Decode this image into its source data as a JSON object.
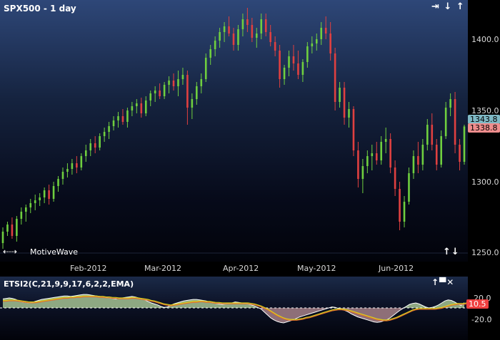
{
  "price_panel": {
    "title": "SPX500 - 1 day",
    "branding": "MotiveWave",
    "controls": {
      "right": "⇥ ↓ ↑"
    },
    "nav_arrows": "⇠⇢",
    "y_ticks": [
      "1400.0",
      "1350.0",
      "1300.0",
      "1250.0"
    ],
    "price_badges": {
      "last": "1343.8",
      "current": "1338.8"
    }
  },
  "date_axis": {
    "labels": [
      "Feb-2012",
      "Mar-2012",
      "Apr-2012",
      "May-2012",
      "Jun-2012"
    ]
  },
  "indicator_panel": {
    "title": "ETSI2(C,21,9,9,17,6,2,2,EMA)",
    "y_ticks": [
      "20.0",
      "-20.0"
    ],
    "value_badge": "10.5"
  },
  "colors": {
    "up": "#6fcf3f",
    "down": "#e04040",
    "neutral": "#d0d0d0",
    "ind_fill_pos": "#8ea882",
    "ind_fill_neg": "#8e6f78",
    "ind_line": "#ffffff",
    "signal_line": "#d8d020",
    "signal_line2": "#e26d2a",
    "badge_last_bg": "#7fb9c5",
    "badge_current_bg": "#f08d8d",
    "ind_badge_bg": "#ef4040"
  },
  "chart_data": [
    {
      "type": "candlestick",
      "title": "SPX500 - 1 day",
      "ylim": [
        1245,
        1425
      ],
      "x_labels": [
        "Feb-2012",
        "Mar-2012",
        "Apr-2012",
        "May-2012",
        "Jun-2012"
      ],
      "ohlc": [
        [
          1257,
          1268,
          1253,
          1265
        ],
        [
          1265,
          1272,
          1262,
          1270
        ],
        [
          1270,
          1275,
          1260,
          1262
        ],
        [
          1262,
          1276,
          1258,
          1274
        ],
        [
          1274,
          1282,
          1270,
          1279
        ],
        [
          1279,
          1284,
          1272,
          1282
        ],
        [
          1282,
          1288,
          1278,
          1285
        ],
        [
          1285,
          1291,
          1280,
          1287
        ],
        [
          1287,
          1292,
          1283,
          1289
        ],
        [
          1289,
          1296,
          1285,
          1294
        ],
        [
          1294,
          1298,
          1284,
          1288
        ],
        [
          1288,
          1300,
          1286,
          1297
        ],
        [
          1297,
          1304,
          1293,
          1302
        ],
        [
          1302,
          1310,
          1298,
          1307
        ],
        [
          1307,
          1313,
          1303,
          1309
        ],
        [
          1309,
          1316,
          1305,
          1313
        ],
        [
          1313,
          1318,
          1306,
          1310
        ],
        [
          1310,
          1320,
          1308,
          1318
        ],
        [
          1318,
          1326,
          1314,
          1322
        ],
        [
          1322,
          1330,
          1318,
          1327
        ],
        [
          1327,
          1332,
          1320,
          1324
        ],
        [
          1324,
          1334,
          1322,
          1332
        ],
        [
          1332,
          1338,
          1328,
          1335
        ],
        [
          1335,
          1342,
          1330,
          1339
        ],
        [
          1339,
          1346,
          1336,
          1343
        ],
        [
          1343,
          1349,
          1338,
          1346
        ],
        [
          1346,
          1351,
          1340,
          1342
        ],
        [
          1342,
          1352,
          1338,
          1350
        ],
        [
          1350,
          1356,
          1346,
          1353
        ],
        [
          1353,
          1358,
          1348,
          1355
        ],
        [
          1355,
          1359,
          1345,
          1348
        ],
        [
          1348,
          1360,
          1346,
          1357
        ],
        [
          1357,
          1364,
          1353,
          1362
        ],
        [
          1362,
          1367,
          1356,
          1364
        ],
        [
          1364,
          1369,
          1358,
          1360
        ],
        [
          1360,
          1370,
          1358,
          1368
        ],
        [
          1368,
          1374,
          1362,
          1371
        ],
        [
          1371,
          1376,
          1364,
          1367
        ],
        [
          1367,
          1378,
          1360,
          1372
        ],
        [
          1372,
          1380,
          1368,
          1375
        ],
        [
          1375,
          1378,
          1340,
          1352
        ],
        [
          1352,
          1362,
          1344,
          1358
        ],
        [
          1358,
          1370,
          1354,
          1367
        ],
        [
          1367,
          1376,
          1362,
          1372
        ],
        [
          1372,
          1390,
          1370,
          1387
        ],
        [
          1387,
          1396,
          1382,
          1393
        ],
        [
          1393,
          1402,
          1388,
          1399
        ],
        [
          1399,
          1408,
          1394,
          1405
        ],
        [
          1405,
          1412,
          1398,
          1409
        ],
        [
          1409,
          1416,
          1402,
          1404
        ],
        [
          1404,
          1408,
          1392,
          1396
        ],
        [
          1396,
          1410,
          1392,
          1407
        ],
        [
          1407,
          1418,
          1402,
          1414
        ],
        [
          1414,
          1422,
          1405,
          1410
        ],
        [
          1410,
          1415,
          1398,
          1401
        ],
        [
          1401,
          1408,
          1394,
          1404
        ],
        [
          1404,
          1418,
          1400,
          1414
        ],
        [
          1414,
          1418,
          1402,
          1405
        ],
        [
          1405,
          1410,
          1395,
          1398
        ],
        [
          1398,
          1402,
          1388,
          1392
        ],
        [
          1392,
          1396,
          1366,
          1372
        ],
        [
          1372,
          1382,
          1368,
          1380
        ],
        [
          1380,
          1392,
          1374,
          1388
        ],
        [
          1388,
          1396,
          1378,
          1383
        ],
        [
          1383,
          1392,
          1372,
          1375
        ],
        [
          1375,
          1386,
          1370,
          1384
        ],
        [
          1384,
          1398,
          1380,
          1395
        ],
        [
          1395,
          1402,
          1390,
          1397
        ],
        [
          1397,
          1404,
          1392,
          1400
        ],
        [
          1400,
          1412,
          1396,
          1408
        ],
        [
          1408,
          1416,
          1400,
          1404
        ],
        [
          1404,
          1412,
          1385,
          1390
        ],
        [
          1390,
          1394,
          1350,
          1356
        ],
        [
          1356,
          1370,
          1352,
          1366
        ],
        [
          1366,
          1370,
          1340,
          1345
        ],
        [
          1345,
          1356,
          1338,
          1351
        ],
        [
          1351,
          1353,
          1318,
          1322
        ],
        [
          1322,
          1328,
          1296,
          1302
        ],
        [
          1302,
          1316,
          1292,
          1311
        ],
        [
          1311,
          1322,
          1306,
          1318
        ],
        [
          1318,
          1326,
          1308,
          1320
        ],
        [
          1320,
          1328,
          1312,
          1315
        ],
        [
          1315,
          1332,
          1312,
          1328
        ],
        [
          1328,
          1338,
          1320,
          1330
        ],
        [
          1330,
          1334,
          1306,
          1310
        ],
        [
          1310,
          1315,
          1290,
          1295
        ],
        [
          1295,
          1300,
          1266,
          1272
        ],
        [
          1272,
          1290,
          1268,
          1286
        ],
        [
          1286,
          1310,
          1284,
          1306
        ],
        [
          1306,
          1322,
          1302,
          1318
        ],
        [
          1318,
          1328,
          1306,
          1312
        ],
        [
          1312,
          1330,
          1308,
          1326
        ],
        [
          1326,
          1344,
          1322,
          1340
        ],
        [
          1340,
          1348,
          1322,
          1326
        ],
        [
          1326,
          1330,
          1308,
          1312
        ],
        [
          1312,
          1336,
          1310,
          1332
        ],
        [
          1332,
          1356,
          1330,
          1352
        ],
        [
          1352,
          1362,
          1346,
          1358
        ],
        [
          1358,
          1363,
          1320,
          1326
        ],
        [
          1326,
          1330,
          1308,
          1314
        ],
        [
          1314,
          1340,
          1312,
          1338.8
        ]
      ]
    },
    {
      "type": "area",
      "title": "ETSI2(C,21,9,9,17,6,2,2,EMA)",
      "ylim": [
        -35,
        35
      ],
      "y_ticks": [
        20,
        -20
      ],
      "series": [
        {
          "values": [
            18,
            19,
            20,
            19,
            17,
            14,
            12,
            11,
            10,
            11,
            13,
            15,
            17,
            18,
            19,
            20,
            21,
            22,
            23,
            24,
            24,
            23,
            24,
            25,
            26,
            27,
            27,
            26,
            25,
            24,
            23,
            22,
            21,
            20,
            19,
            18,
            19,
            20,
            21,
            22,
            23,
            22,
            20,
            18,
            16,
            13,
            10,
            8,
            6,
            3,
            1,
            2,
            5,
            8,
            10,
            12,
            14,
            15,
            16,
            17,
            17,
            16,
            15,
            14,
            12,
            11,
            9,
            8,
            7,
            8,
            9,
            10,
            12,
            11,
            10,
            9,
            8,
            6,
            4,
            1,
            -2,
            -8,
            -14,
            -20,
            -24,
            -27,
            -29,
            -30,
            -28,
            -26,
            -24,
            -21,
            -18,
            -16,
            -14,
            -12,
            -10,
            -8,
            -6,
            -4,
            -2,
            0,
            2,
            1,
            -1,
            -3,
            -5,
            -8,
            -12,
            -15,
            -18,
            -20,
            -22,
            -24,
            -26,
            -28,
            -29,
            -28,
            -26,
            -24,
            -20,
            -15,
            -10,
            -5,
            -1,
            3,
            7,
            9,
            10,
            8,
            5,
            2,
            0,
            1,
            3,
            6,
            10,
            14,
            16,
            15,
            12,
            8,
            5,
            10.5
          ]
        },
        {
          "values": [
            15,
            15,
            16,
            16,
            16,
            15,
            14,
            13,
            12,
            12,
            12,
            13,
            14,
            15,
            16,
            17,
            18,
            19,
            20,
            21,
            21,
            22,
            22,
            23,
            23,
            24,
            24,
            24,
            24,
            24,
            23,
            23,
            22,
            22,
            21,
            21,
            20,
            20,
            20,
            20,
            21,
            21,
            20,
            19,
            18,
            17,
            15,
            14,
            12,
            10,
            8,
            7,
            6,
            7,
            8,
            9,
            10,
            11,
            12,
            13,
            13,
            14,
            14,
            13,
            13,
            12,
            11,
            11,
            10,
            10,
            10,
            10,
            10,
            10,
            10,
            10,
            10,
            9,
            8,
            6,
            4,
            1,
            -2,
            -6,
            -10,
            -14,
            -17,
            -20,
            -22,
            -23,
            -23,
            -23,
            -22,
            -21,
            -19,
            -18,
            -16,
            -14,
            -12,
            -10,
            -8,
            -6,
            -4,
            -3,
            -2,
            -2,
            -3,
            -4,
            -6,
            -8,
            -10,
            -12,
            -14,
            -16,
            -18,
            -20,
            -22,
            -23,
            -24,
            -24,
            -23,
            -21,
            -19,
            -16,
            -13,
            -10,
            -7,
            -4,
            -2,
            -1,
            -1,
            -1,
            -1,
            -1,
            -1,
            0,
            1,
            3,
            5,
            7,
            8,
            9,
            9,
            9,
            10.5
          ]
        }
      ]
    }
  ]
}
